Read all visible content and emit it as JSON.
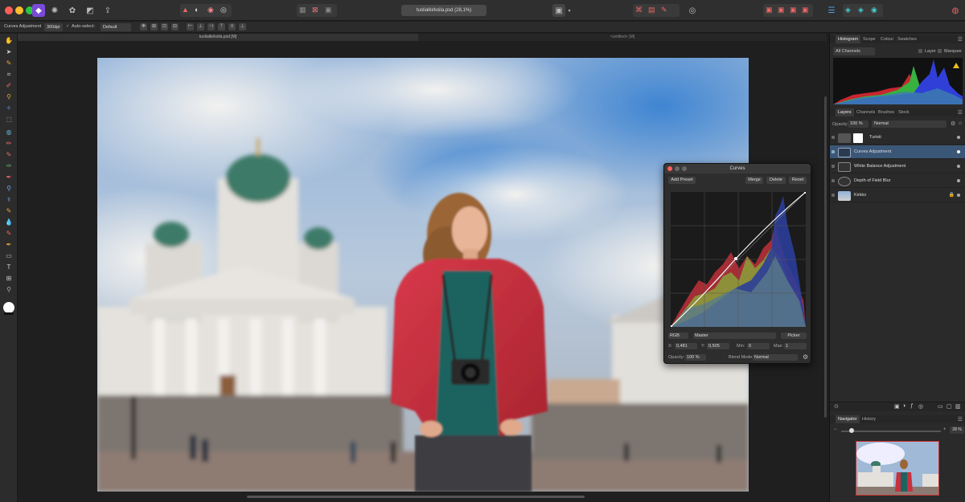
{
  "document": {
    "title": "tuolialkirkoila.psd (28,1%)",
    "tab_main": "tuolialkirkoila.psd [M]",
    "tab_second": "<untitled> [M]"
  },
  "context_toolbar": {
    "tool_name": "Curves Adjustment",
    "dpi": "300dpi",
    "auto_select": "Auto-select:",
    "auto_select_value": "Default"
  },
  "histogram_panel": {
    "tabs": [
      "Histogram",
      "Scope",
      "Colour",
      "Swatches"
    ],
    "channels": "All Channels",
    "layer_label": "Layer",
    "marquee_label": "Marquee"
  },
  "layers_panel": {
    "tabs": [
      "Layers",
      "Channels",
      "Brushes",
      "Stock"
    ],
    "opacity_label": "Opacity:",
    "opacity_value": "100 %",
    "blend_mode": "Normal",
    "layers": [
      {
        "name": "Turisti",
        "selected": false
      },
      {
        "name": "Curves Adjustment",
        "selected": true
      },
      {
        "name": "White Balance Adjustment",
        "selected": false
      },
      {
        "name": "Depth of Field Blur",
        "selected": false
      },
      {
        "name": "Kirkko",
        "selected": false
      }
    ]
  },
  "navigator_panel": {
    "tabs": [
      "Navigator",
      "History"
    ],
    "zoom": "28 %"
  },
  "curves_dialog": {
    "title": "Curves",
    "add_preset": "Add Preset",
    "merge": "Merge",
    "delete": "Delete",
    "reset": "Reset",
    "channel": "RGB",
    "mode": "Master",
    "picker": "Picker",
    "x_label": "X:",
    "x_value": "0,481",
    "y_label": "Y:",
    "y_value": "0,505",
    "min_label": "Min:",
    "min_value": "0",
    "max_label": "Max:",
    "max_value": "1",
    "opacity_label": "Opacity:",
    "opacity_value": "100 %",
    "blend_label": "Blend Mode:",
    "blend_value": "Normal"
  },
  "colors": {
    "accent_selected": "#3b5778",
    "affinity_purple": "#7a4ad8"
  }
}
